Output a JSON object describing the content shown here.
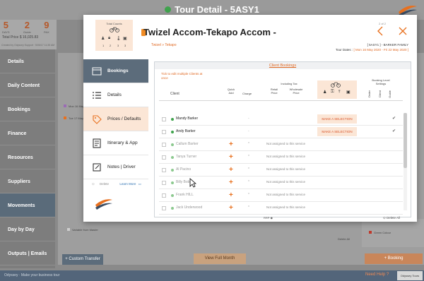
{
  "app": {
    "title": "Tour Detail - 5ASY1",
    "status_color": "#3fa34d",
    "stats": [
      {
        "value": "5",
        "label": "DAYS"
      },
      {
        "value": "2",
        "label": "Guide"
      },
      {
        "value": "9",
        "label": "PAX"
      }
    ],
    "total_label": "Total Price",
    "total_value": "$ 16,025.83",
    "created": "Created by Odyssey Support · 5/06/17 11:35 AM",
    "sidebar": [
      "Details",
      "Daily Content",
      "Bookings",
      "Finance",
      "Resources",
      "Suppliers",
      "Movements",
      "Day by Day",
      "Outputs | Emails"
    ],
    "sidebar_active": "Movements",
    "tour_rows": [
      "Mon 16 May 2020",
      "Tue 17 May 2020"
    ],
    "legend": [
      "Variable from Master",
      "Green Colour"
    ],
    "buttons": {
      "custom_transfer": "Custom Transfer",
      "view_full_month": "View Full Month",
      "booking": "Booking",
      "delete_all_bg": "Delete All"
    },
    "footer": {
      "brand": "Odyssey · Make your business tour",
      "help": "Need Help ?",
      "logo": "Odyssey Tours"
    }
  },
  "modal": {
    "counts_title": "Total Counts",
    "counts": [
      "1",
      "2",
      "3",
      "3"
    ],
    "title": "Twizel Accom-Tekapo Accom -",
    "subtitle": "Twizel » Tekapo",
    "page_indicator": "2 of 2",
    "family": "[ 5ASY1 ] - BARKER FAMILY",
    "dates_label": "Tour Dates :",
    "dates_value": "[ Mon 16 May 2020 - Fri 22 May 2020 ]",
    "tabs": [
      {
        "label": "Bookings",
        "icon": "bookings-icon"
      },
      {
        "label": "Details",
        "icon": "list-icon"
      },
      {
        "label": "Prices / Defaults",
        "icon": "price-tag-icon"
      },
      {
        "label": "Itinerary & App",
        "icon": "itinerary-icon"
      },
      {
        "label": "Notes | Driver",
        "icon": "notes-icon"
      }
    ],
    "delete_link": "Delete",
    "learn_more": "Learn More",
    "bookings": {
      "header": "Client Bookings",
      "tick_note": "Tick to edit multiple Clients at once",
      "columns": {
        "client": "Client",
        "quick_add": "Quick Add",
        "charge": "Charge",
        "including_tax": "Including Tax",
        "retail": "Retail Price",
        "wholesale": "Wholesale Price",
        "booking_level": "Booking Level Settings",
        "flags": [
          "Order",
          "Client",
          "Guide"
        ]
      },
      "rows": [
        {
          "name": "Mandy Barker",
          "active": true,
          "dot": "#3fa34d",
          "charge": "-",
          "note": "",
          "make": "MAKE A SELECTION",
          "tick": "✔"
        },
        {
          "name": "Andy Barker",
          "active": true,
          "dot": "#3fa34d",
          "charge": "-",
          "note": "",
          "make": "MAKE A SELECTION",
          "tick": "✔"
        },
        {
          "name": "Callum Barker",
          "active": false,
          "dot": "#8cc98f",
          "charge": "*",
          "note": "Not assigned to this service",
          "make": "",
          "tick": ""
        },
        {
          "name": "Tanya Turner",
          "active": false,
          "dot": "#8cc98f",
          "charge": "*",
          "note": "Not assigned to this service",
          "make": "",
          "tick": ""
        },
        {
          "name": "Al Pacino",
          "active": false,
          "dot": "#8cc98f",
          "charge": "*",
          "note": "Not assigned to this service",
          "make": "",
          "tick": ""
        },
        {
          "name": "Billy Bob",
          "active": false,
          "dot": "#8cc98f",
          "charge": "*",
          "note": "Not assigned to this service",
          "make": "",
          "tick": ""
        },
        {
          "name": "Frank HILL",
          "active": false,
          "dot": "#8cc98f",
          "charge": "*",
          "note": "Not assigned to this service",
          "make": "",
          "tick": ""
        },
        {
          "name": "Jack Underwood",
          "active": false,
          "dot": "#8cc98f",
          "charge": "*",
          "note": "Not assigned to this service",
          "make": "",
          "tick": ""
        }
      ],
      "rrp": "RRP",
      "delete_all": "Delete All"
    }
  },
  "colors": {
    "accent": "#e8701e",
    "nav_dark": "#5c6c7b",
    "highlight": "#fbe6d6"
  }
}
